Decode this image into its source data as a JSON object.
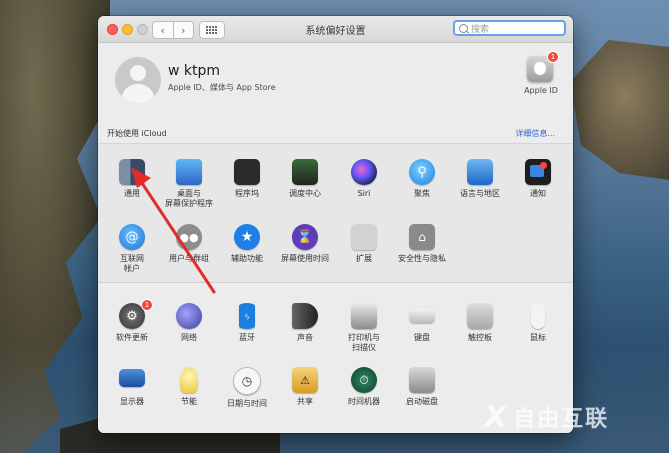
{
  "window": {
    "title": "系统偏好设置",
    "search_placeholder": "搜索"
  },
  "user": {
    "name": "w ktpm",
    "subtitle": "Apple ID、媒体与 App Store",
    "apple_id_label": "Apple ID",
    "apple_id_badge": "1"
  },
  "icloud": {
    "prompt": "开始使用 iCloud",
    "details_link": "详细信息..."
  },
  "panes_row1": [
    {
      "label": "通用",
      "icon": "general-icon"
    },
    {
      "label": "桌面与\n屏幕保护程序",
      "icon": "desktop-screensaver-icon"
    },
    {
      "label": "程序坞",
      "icon": "dock-icon"
    },
    {
      "label": "调度中心",
      "icon": "mission-control-icon"
    },
    {
      "label": "Siri",
      "icon": "siri-icon"
    },
    {
      "label": "聚焦",
      "icon": "spotlight-icon"
    },
    {
      "label": "语言与地区",
      "icon": "language-region-icon"
    },
    {
      "label": "通知",
      "icon": "notifications-icon"
    }
  ],
  "panes_row2": [
    {
      "label": "互联网\n帐户",
      "icon": "internet-accounts-icon"
    },
    {
      "label": "用户与群组",
      "icon": "users-groups-icon"
    },
    {
      "label": "辅助功能",
      "icon": "accessibility-icon"
    },
    {
      "label": "屏幕使用时间",
      "icon": "screen-time-icon"
    },
    {
      "label": "扩展",
      "icon": "extensions-icon"
    },
    {
      "label": "安全性与隐私",
      "icon": "security-privacy-icon"
    }
  ],
  "panes_row3": [
    {
      "label": "软件更新",
      "icon": "software-update-icon",
      "badge": "1"
    },
    {
      "label": "网络",
      "icon": "network-icon"
    },
    {
      "label": "蓝牙",
      "icon": "bluetooth-icon"
    },
    {
      "label": "声音",
      "icon": "sound-icon"
    },
    {
      "label": "打印机与\n扫描仪",
      "icon": "printers-scanners-icon"
    },
    {
      "label": "键盘",
      "icon": "keyboard-icon"
    },
    {
      "label": "触控板",
      "icon": "trackpad-icon"
    },
    {
      "label": "鼠标",
      "icon": "mouse-icon"
    }
  ],
  "panes_row4": [
    {
      "label": "显示器",
      "icon": "displays-icon"
    },
    {
      "label": "节能",
      "icon": "energy-saver-icon"
    },
    {
      "label": "日期与时间",
      "icon": "date-time-icon"
    },
    {
      "label": "共享",
      "icon": "sharing-icon"
    },
    {
      "label": "时间机器",
      "icon": "time-machine-icon"
    },
    {
      "label": "启动磁盘",
      "icon": "startup-disk-icon"
    }
  ],
  "watermark": {
    "text": "自由互联"
  },
  "colors": {
    "link": "#2c64c9",
    "badge": "#f2493c",
    "annotation_arrow": "#e32b2b"
  }
}
